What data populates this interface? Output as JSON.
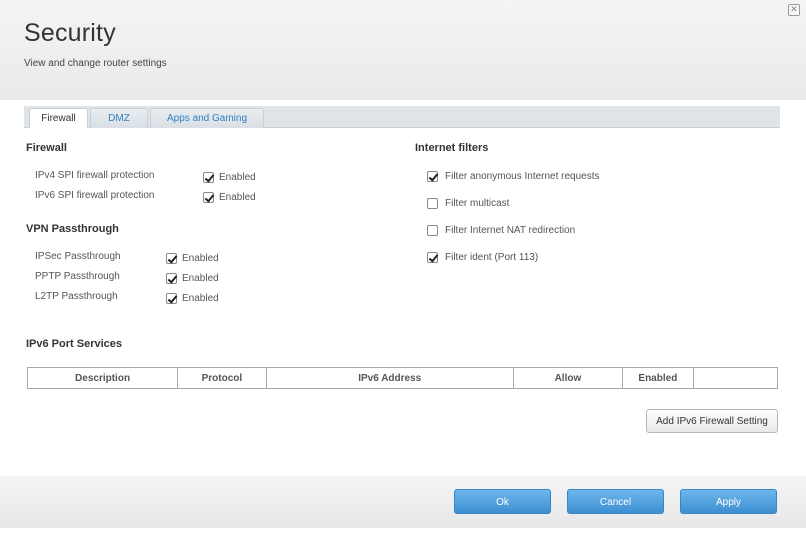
{
  "header": {
    "title": "Security",
    "subtitle": "View and change router settings"
  },
  "tabs": [
    {
      "label": "Firewall",
      "active": true
    },
    {
      "label": "DMZ",
      "active": false
    },
    {
      "label": "Apps and Gaming",
      "active": false
    }
  ],
  "firewall": {
    "title": "Firewall",
    "rows": [
      {
        "label": "IPv4 SPI firewall protection",
        "checked": true,
        "status": "Enabled"
      },
      {
        "label": "IPv6 SPI firewall protection",
        "checked": true,
        "status": "Enabled"
      }
    ]
  },
  "vpn": {
    "title": "VPN Passthrough",
    "rows": [
      {
        "label": "IPSec Passthrough",
        "checked": true,
        "status": "Enabled"
      },
      {
        "label": "PPTP Passthrough",
        "checked": true,
        "status": "Enabled"
      },
      {
        "label": "L2TP Passthrough",
        "checked": true,
        "status": "Enabled"
      }
    ]
  },
  "internet_filters": {
    "title": "Internet filters",
    "items": [
      {
        "label": "Filter anonymous Internet requests",
        "checked": true
      },
      {
        "label": "Filter multicast",
        "checked": false
      },
      {
        "label": "Filter Internet NAT redirection",
        "checked": false
      },
      {
        "label": "Filter ident (Port 113)",
        "checked": true
      }
    ]
  },
  "ipv6_ports": {
    "title": "IPv6 Port Services",
    "columns": [
      "Description",
      "Protocol",
      "IPv6 Address",
      "Allow",
      "Enabled",
      ""
    ],
    "add_button": "Add IPv6 Firewall Setting"
  },
  "footer": {
    "ok": "Ok",
    "cancel": "Cancel",
    "apply": "Apply"
  }
}
